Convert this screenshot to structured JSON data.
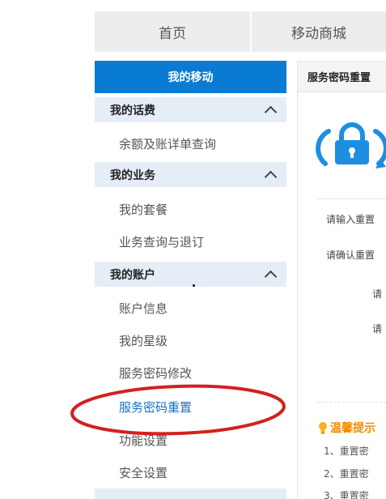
{
  "nav": {
    "tabs": [
      "首页",
      "移动商城"
    ]
  },
  "sidebar": {
    "header": "我的移动",
    "groups": [
      {
        "title": "我的话费",
        "items": [
          "余额及账详单查询"
        ]
      },
      {
        "title": "我的业务",
        "items": [
          "我的套餐",
          "业务查询与退订"
        ]
      },
      {
        "title": "我的账户",
        "items": [
          "账户信息",
          "我的星级",
          "服务密码修改",
          "服务密码重置",
          "功能设置",
          "安全设置"
        ]
      }
    ]
  },
  "main": {
    "title": "服务密码重置",
    "form": {
      "label1": "请输入重置",
      "label2": "请确认重置",
      "label3": "请",
      "label4": "请"
    },
    "tips": {
      "title": "温馨提示",
      "lines": [
        "1、重置密",
        "2、重置密",
        "3、重置密"
      ]
    }
  },
  "colors": {
    "brand_blue": "#0a7bd3",
    "sidebar_group_bg": "#e5eef7",
    "active_link": "#1a6fc4",
    "annotation_red": "#d42020",
    "tip_orange": "#f08c00"
  }
}
